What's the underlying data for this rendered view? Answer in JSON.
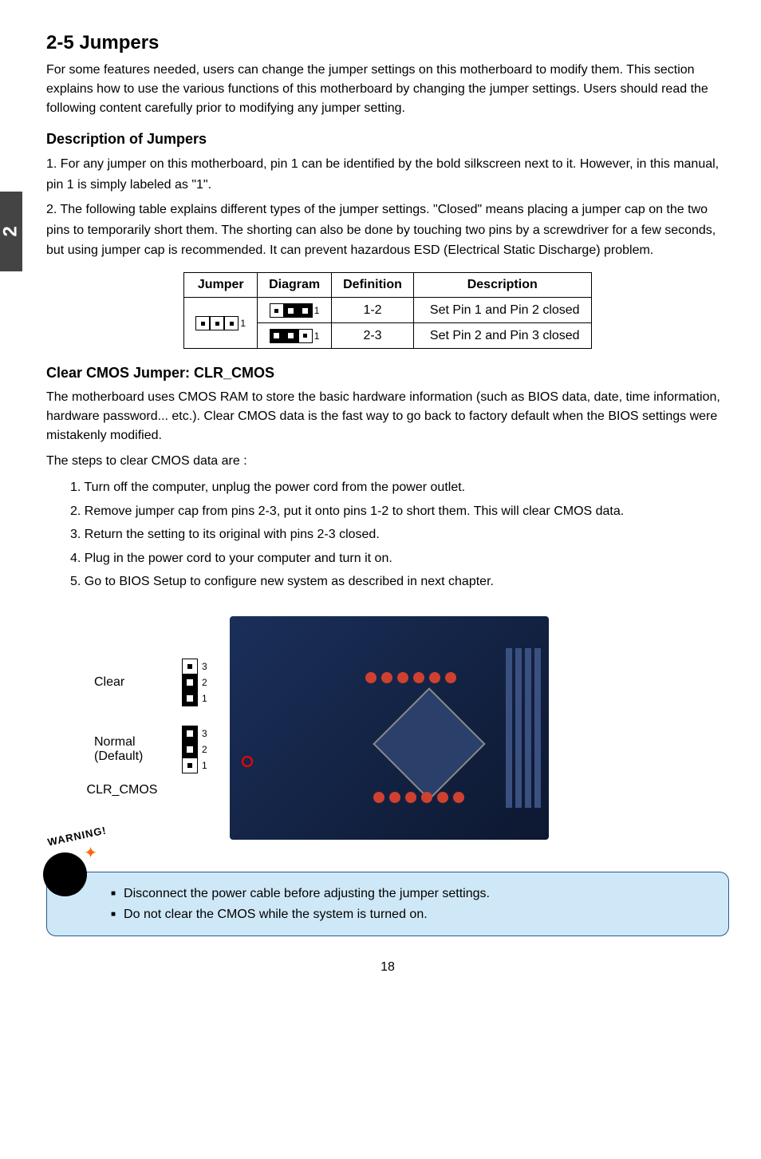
{
  "sideTab": "2",
  "heading": "2-5 Jumpers",
  "intro": "For some features needed, users can change the jumper settings on this motherboard to modify them. This section explains how to use the various functions of this motherboard by changing the jumper settings. Users should read the following content carefully prior to modifying any jumper setting.",
  "descHeading": "Description of Jumpers",
  "descList": [
    "1. For any jumper on this motherboard, pin 1 can be identified by the bold silkscreen next to it. However, in this manual, pin 1 is simply labeled as \"1\".",
    "2. The following table explains different types of the jumper settings. \"Closed\" means placing a jumper cap on the two pins to temporarily short them. The shorting can also be done by touching two pins by a screwdriver for a few seconds, but using jumper cap is recommended. It can prevent hazardous ESD (Electrical Static Discharge) problem."
  ],
  "table": {
    "headers": [
      "Jumper",
      "Diagram",
      "Definition",
      "Description"
    ],
    "rows": [
      {
        "definition": "1-2",
        "description": "Set Pin 1 and Pin 2 closed"
      },
      {
        "definition": "2-3",
        "description": "Set Pin 2 and Pin 3 closed"
      }
    ],
    "pinLabel": "1"
  },
  "clearCmosHeading": "Clear CMOS Jumper: CLR_CMOS",
  "clearCmosIntro": "The motherboard uses CMOS RAM to store the basic hardware information (such as BIOS data, date, time information, hardware password... etc.). Clear CMOS data is the fast way to go back to factory default when the BIOS settings were mistakenly modified.",
  "stepsIntro": "The steps to clear CMOS data are :",
  "steps": [
    "1. Turn off the computer, unplug the power cord from the power outlet.",
    "2. Remove jumper cap from pins 2-3, put it onto pins 1-2 to short them. This will clear CMOS data.",
    "3. Return the setting to its original with pins 2-3 closed.",
    "4. Plug in the power cord to your computer and turn it on.",
    "5. Go to BIOS Setup to configure new system as described in next chapter."
  ],
  "jumperDiagram": {
    "clearLabel": "Clear",
    "normalLabel": "Normal",
    "defaultLabel": "(Default)",
    "pin1": "1",
    "pin2": "2",
    "pin3": "3",
    "name": "CLR_CMOS"
  },
  "warningArc": "WARNING!",
  "warnings": [
    "Disconnect the power cable before adjusting the jumper settings.",
    "Do not clear the CMOS while the system is turned on."
  ],
  "pageNumber": "18"
}
